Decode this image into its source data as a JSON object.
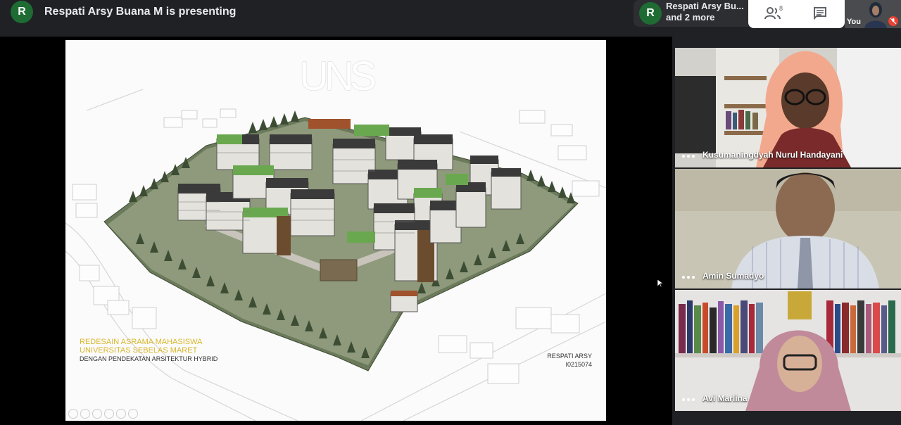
{
  "topbar": {
    "presenter_initial": "R",
    "presenting_text": "Respati Arsy Buana M is presenting",
    "participants_initial": "R",
    "participants_line1": "Respati Arsy Bu...",
    "participants_line2": "and 2 more",
    "people_count": "8",
    "self_label": "You"
  },
  "slide": {
    "title": "UNS",
    "caption_line1": "REDESAIN ASRAMA MAHASISWA",
    "caption_line2": "UNIVERSITAS SEBELAS MARET",
    "caption_line3": "DENGAN PENDEKATAN ARSITEKTUR HYBRID",
    "author_name": "RESPATI ARSY",
    "author_id": "I0215074"
  },
  "tiles": [
    {
      "name": "Kusumaningdyah Nurul Handayani"
    },
    {
      "name": "Amin Sumadyo"
    },
    {
      "name": "Avi Marlina"
    }
  ],
  "colors": {
    "background": "#202124",
    "avatar": "#1e6b34",
    "caption_gold": "#d9b62a",
    "mic_off": "#ea4335"
  },
  "icons": [
    "people-icon",
    "chat-icon",
    "mic-off-icon",
    "cursor-icon"
  ]
}
